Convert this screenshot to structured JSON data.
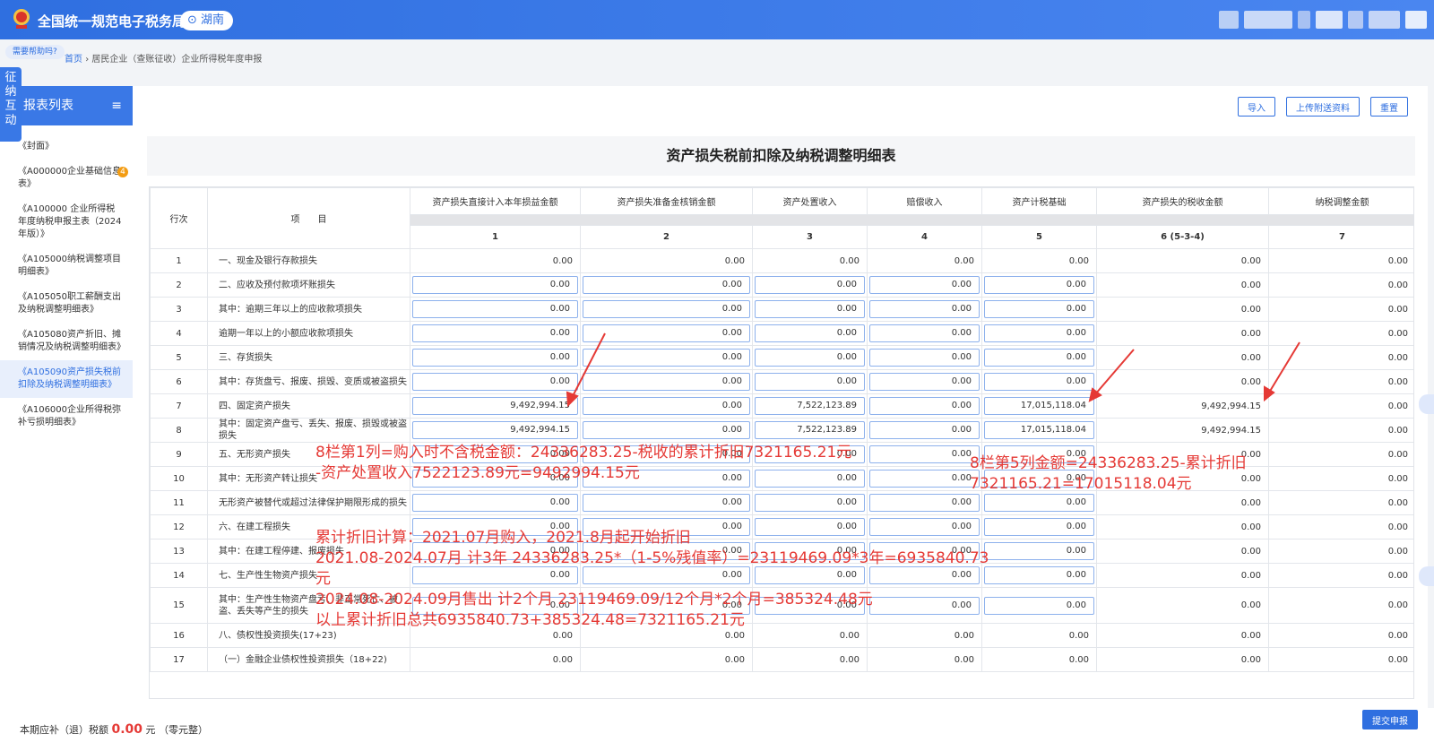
{
  "topbar": {
    "title": "全国统一规范电子税务局",
    "region": "湖南"
  },
  "help": "需要帮助吗?",
  "breadcrumb": {
    "home": "首页",
    "sep": "›",
    "current": "居民企业（查账征收）企业所得税年度申报"
  },
  "left_band": "征纳互动",
  "sidebar": {
    "title": "报表列表",
    "items": [
      "《封面》",
      "《A000000企业基础信息表》",
      "《A100000 企业所得税年度纳税申报主表（2024年版）》",
      "《A105000纳税调整项目明细表》",
      "《A105050职工薪酬支出及纳税调整明细表》",
      "《A105080资产折旧、摊销情况及纳税调整明细表》",
      "《A105090资产损失税前扣除及纳税调整明细表》",
      "《A106000企业所得税弥补亏损明细表》"
    ],
    "badge": "4"
  },
  "toolbar": {
    "import": "导入",
    "upload": "上传附送资料",
    "reset": "重置"
  },
  "sheet_title": "资产损失税前扣除及纳税调整明细表",
  "table": {
    "head_rowno": "行次",
    "head_item": "项　　目",
    "columns": [
      "资产损失直接计入本年损益金额",
      "资产损失准备金核销金额",
      "资产处置收入",
      "赔偿收入",
      "资产计税基础",
      "资产损失的税收金额",
      "纳税调整金额"
    ],
    "col_numbers": [
      "1",
      "2",
      "3",
      "4",
      "5",
      "6 (5-3-4)",
      "7"
    ],
    "rows": [
      {
        "no": "1",
        "item": "一、现金及银行存款损失",
        "v": [
          "0.00",
          "0.00",
          "0.00",
          "0.00",
          "0.00",
          "0.00",
          "0.00"
        ]
      },
      {
        "no": "2",
        "item": "二、应收及预付款项坏账损失",
        "v": [
          "0.00",
          "0.00",
          "0.00",
          "0.00",
          "0.00",
          "0.00",
          "0.00"
        ]
      },
      {
        "no": "3",
        "item": "其中：逾期三年以上的应收款项损失",
        "v": [
          "0.00",
          "0.00",
          "0.00",
          "0.00",
          "0.00",
          "0.00",
          "0.00"
        ]
      },
      {
        "no": "4",
        "item": "逾期一年以上的小额应收款项损失",
        "v": [
          "0.00",
          "0.00",
          "0.00",
          "0.00",
          "0.00",
          "0.00",
          "0.00"
        ]
      },
      {
        "no": "5",
        "item": "三、存货损失",
        "v": [
          "0.00",
          "0.00",
          "0.00",
          "0.00",
          "0.00",
          "0.00",
          "0.00"
        ]
      },
      {
        "no": "6",
        "item": "其中：存货盘亏、报废、损毁、变质或被盗损失",
        "v": [
          "0.00",
          "0.00",
          "0.00",
          "0.00",
          "0.00",
          "0.00",
          "0.00"
        ]
      },
      {
        "no": "7",
        "item": "四、固定资产损失",
        "v": [
          "9,492,994.15",
          "0.00",
          "7,522,123.89",
          "0.00",
          "17,015,118.04",
          "9,492,994.15",
          "0.00"
        ]
      },
      {
        "no": "8",
        "item": "其中：固定资产盘亏、丢失、报废、损毁或被盗损失",
        "v": [
          "9,492,994.15",
          "0.00",
          "7,522,123.89",
          "0.00",
          "17,015,118.04",
          "9,492,994.15",
          "0.00"
        ]
      },
      {
        "no": "9",
        "item": "五、无形资产损失",
        "v": [
          "0.00",
          "0.00",
          "0.00",
          "0.00",
          "0.00",
          "0.00",
          "0.00"
        ]
      },
      {
        "no": "10",
        "item": "其中：无形资产转让损失",
        "v": [
          "0.00",
          "0.00",
          "0.00",
          "0.00",
          "0.00",
          "0.00",
          "0.00"
        ]
      },
      {
        "no": "11",
        "item": "无形资产被替代或超过法律保护期限形成的损失",
        "v": [
          "0.00",
          "0.00",
          "0.00",
          "0.00",
          "0.00",
          "0.00",
          "0.00"
        ]
      },
      {
        "no": "12",
        "item": "六、在建工程损失",
        "v": [
          "0.00",
          "0.00",
          "0.00",
          "0.00",
          "0.00",
          "0.00",
          "0.00"
        ]
      },
      {
        "no": "13",
        "item": "其中：在建工程停建、报废损失",
        "v": [
          "0.00",
          "0.00",
          "0.00",
          "0.00",
          "0.00",
          "0.00",
          "0.00"
        ]
      },
      {
        "no": "14",
        "item": "七、生产性生物资产损失",
        "v": [
          "0.00",
          "0.00",
          "0.00",
          "0.00",
          "0.00",
          "0.00",
          "0.00"
        ]
      },
      {
        "no": "15",
        "item": "其中：生产性生物资产盘亏、非正常死亡、被盗、丢失等产生的损失",
        "v": [
          "0.00",
          "0.00",
          "0.00",
          "0.00",
          "0.00",
          "0.00",
          "0.00"
        ]
      },
      {
        "no": "16",
        "item": "八、债权性投资损失(17+23)",
        "v": [
          "0.00",
          "0.00",
          "0.00",
          "0.00",
          "0.00",
          "0.00",
          "0.00"
        ]
      },
      {
        "no": "17",
        "item": "（一）金融企业债权性投资损失（18+22)",
        "v": [
          "0.00",
          "0.00",
          "0.00",
          "0.00",
          "0.00",
          "0.00",
          "0.00"
        ]
      }
    ]
  },
  "annotations": {
    "a1_line1": "8栏第1列=购入时不含税金额：24336283.25-税收的累计折旧7321165.21元",
    "a1_line2": "-资产处置收入7522123.89元=9492994.15元",
    "a2_line1": "8栏第5列金额=24336283.25-累计折旧",
    "a2_line2": "7321165.21=17015118.04元",
    "a3_line1": "累计折旧计算：2021.07月购入，2021.8月起开始折旧",
    "a3_line2": "2021.08-2024.07月 计3年  24336283.25*（1-5%残值率）=23119469.09*3年=6935840.73",
    "a3_line3": "元",
    "a3_line4": "2024.08-2024.09月售出 计2个月 23119469.09/12个月*2个月=385324.48元",
    "a3_line5": "以上累计折旧总共6935840.73+385324.48=7321165.21元",
    "color": "#e53935"
  },
  "bottom": {
    "prefix": "本期应补（退）税额",
    "amount": "0.00",
    "unit": "元",
    "suffix": "（零元整）",
    "submit": "提交申报"
  }
}
